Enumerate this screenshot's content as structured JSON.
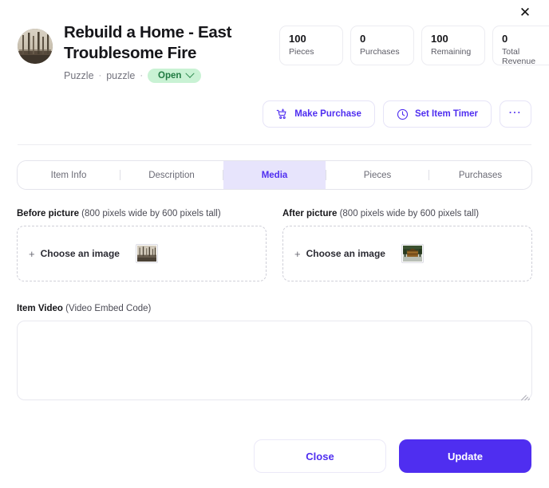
{
  "accent_color": "#4f2ef0",
  "status_color": "#1f7a41",
  "status_bg": "#c9f2d4",
  "close_icon": "✕",
  "header": {
    "avatar_name": "item-avatar-burned-forest",
    "title": "Rebuild a Home - East Troublesome Fire",
    "category": "Puzzle",
    "subcategory": "puzzle",
    "separator": "·",
    "status_label": "Open"
  },
  "stats": [
    {
      "value": "100",
      "label": "Pieces"
    },
    {
      "value": "0",
      "label": "Purchases"
    },
    {
      "value": "100",
      "label": "Remaining"
    },
    {
      "value": "0",
      "label": "Total Revenue"
    }
  ],
  "actions": {
    "make_purchase_label": "Make Purchase",
    "make_purchase_icon": "shopping-cart-plus-icon",
    "set_timer_label": "Set Item Timer",
    "set_timer_icon": "clock-icon",
    "more_label": "···",
    "more_icon": "ellipsis-icon"
  },
  "tabs": [
    {
      "label": "Item Info",
      "active": false
    },
    {
      "label": "Description",
      "active": false
    },
    {
      "label": "Media",
      "active": true
    },
    {
      "label": "Pieces",
      "active": false
    },
    {
      "label": "Purchases",
      "active": false
    }
  ],
  "media": {
    "before": {
      "label": "Before picture",
      "hint": "(800 pixels wide by 600 pixels tall)",
      "choose_label": "Choose an image",
      "plus": "+",
      "thumb_name": "before-picture-thumbnail"
    },
    "after": {
      "label": "After picture",
      "hint": "(800 pixels wide by 600 pixels tall)",
      "choose_label": "Choose an image",
      "plus": "+",
      "thumb_name": "after-picture-thumbnail"
    }
  },
  "video": {
    "label": "Item Video",
    "hint": "(Video Embed Code)",
    "value": "",
    "placeholder": ""
  },
  "footer": {
    "close_label": "Close",
    "update_label": "Update"
  }
}
